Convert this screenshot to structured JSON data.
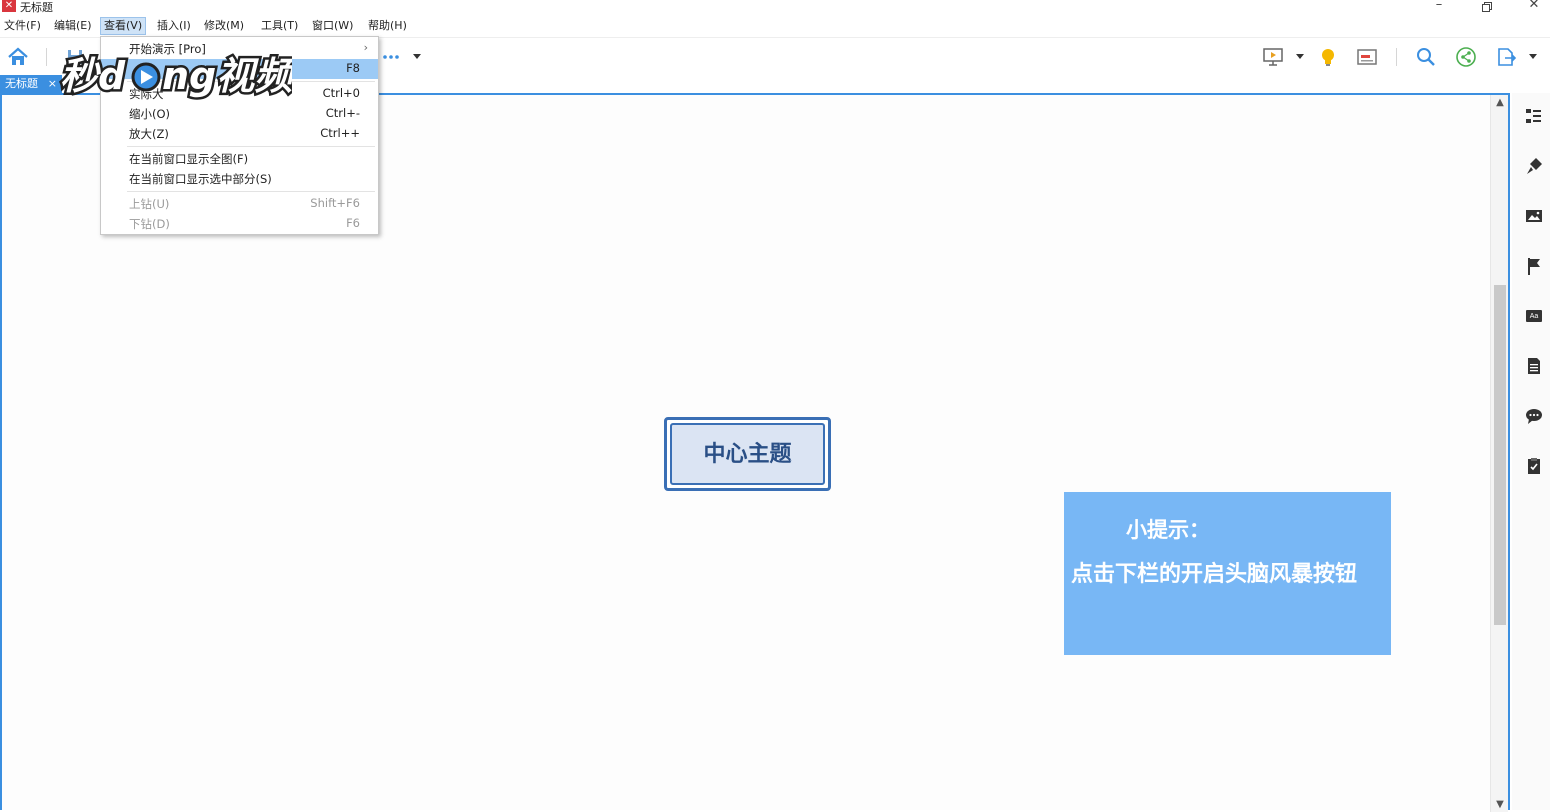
{
  "window": {
    "title": "无标题",
    "controls": [
      "minimize",
      "restore",
      "close"
    ]
  },
  "menubar": {
    "items": [
      {
        "label": "文件(F)"
      },
      {
        "label": "编辑(E)"
      },
      {
        "label": "查看(V)"
      },
      {
        "label": "插入(I)"
      },
      {
        "label": "修改(M)"
      },
      {
        "label": "工具(T)"
      },
      {
        "label": "窗口(W)"
      },
      {
        "label": "帮助(H)"
      }
    ]
  },
  "view_menu": {
    "items": [
      {
        "label": "开始演示 [Pro]",
        "shortcut": ""
      },
      {
        "label": "",
        "shortcut": "F8"
      },
      {
        "label": "实际大",
        "shortcut": "Ctrl+0"
      },
      {
        "label": "缩小(O)",
        "shortcut": "Ctrl+-"
      },
      {
        "label": "放大(Z)",
        "shortcut": "Ctrl++"
      },
      {
        "label": "在当前窗口显示全图(F)",
        "shortcut": ""
      },
      {
        "label": "在当前窗口显示选中部分(S)",
        "shortcut": ""
      },
      {
        "label": "上钻(U)",
        "shortcut": "Shift+F6"
      },
      {
        "label": "下钻(D)",
        "shortcut": "F6"
      }
    ],
    "submenu_arrow": "›"
  },
  "tab": {
    "label": "无标题",
    "close": "×"
  },
  "canvas": {
    "central_topic": "中心主题",
    "tip_title": "小提示：",
    "tip_text": "点击下栏的开启头脑风暴按钮"
  },
  "watermark": {
    "text": "秒dong视频"
  },
  "colors": {
    "accent": "#3b8fe0",
    "tip_bg": "#78b7f5",
    "topic_border": "#3a6fb5",
    "menu_highlight": "#9ccaf5"
  },
  "icons": {
    "toolbar": [
      "home-icon",
      "save-icon",
      "more-icon",
      "presentation-icon",
      "lightbulb-icon",
      "layout-icon",
      "search-icon",
      "share-icon",
      "export-icon"
    ],
    "right_panel": [
      "outline-icon",
      "format-brush-icon",
      "image-icon",
      "flag-icon",
      "text-style-icon",
      "notes-icon",
      "comment-icon",
      "task-icon"
    ]
  }
}
